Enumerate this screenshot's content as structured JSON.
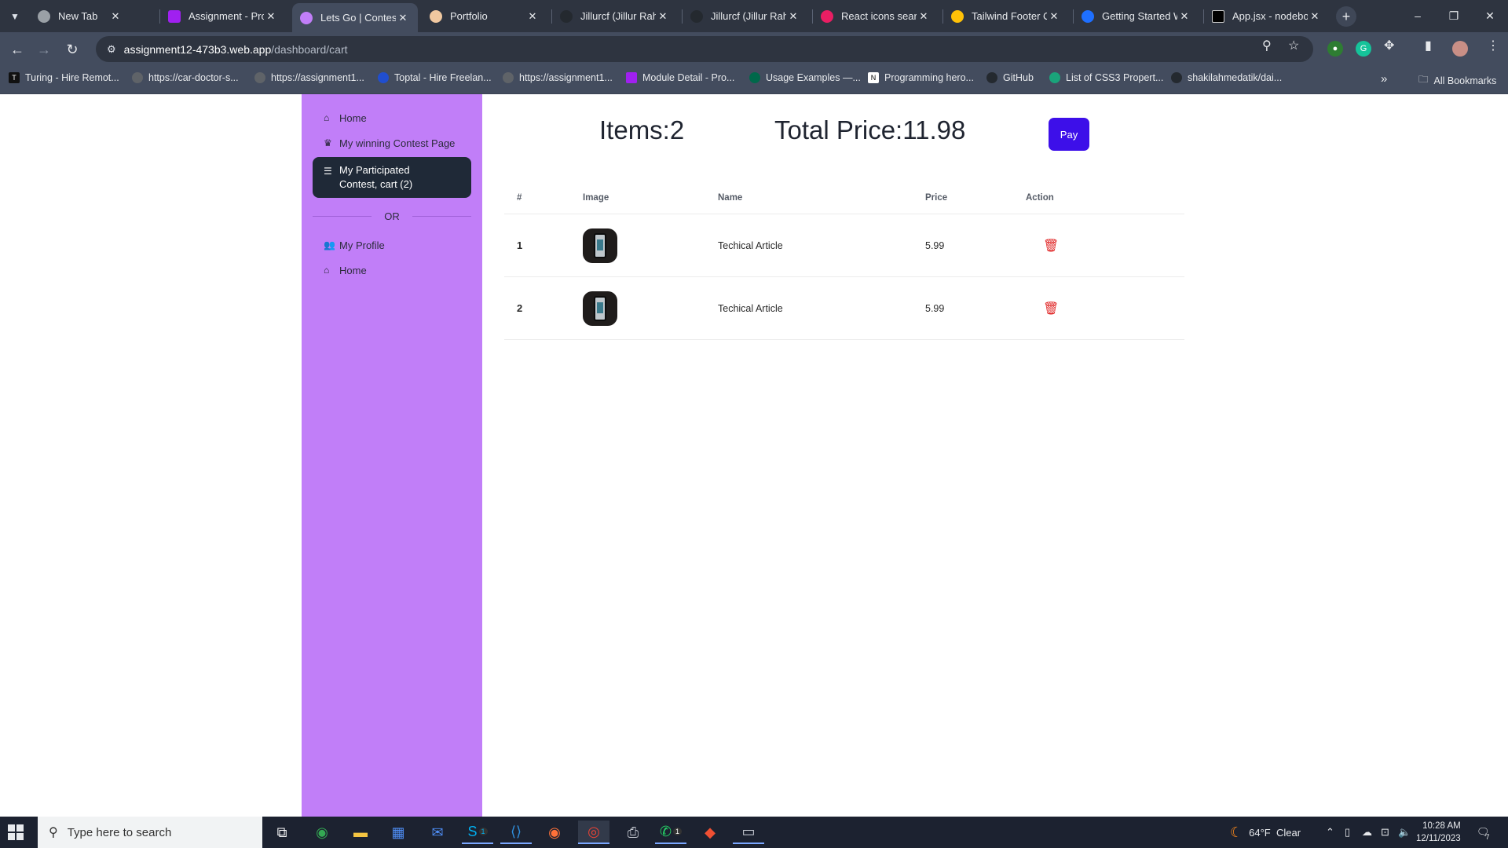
{
  "browser": {
    "tab_search_icon": "chevron-down-icon",
    "tabs": [
      {
        "title": "New Tab",
        "favicon_color": "#9aa0a6"
      },
      {
        "title": "Assignment - Pro",
        "favicon_color": "#a020f0"
      },
      {
        "title": "Lets Go | Contest",
        "favicon_color": "#c17ef8"
      },
      {
        "title": "Portfolio",
        "favicon_color": "#f0c8a0"
      },
      {
        "title": "Jillurcf (Jillur Rahm",
        "favicon_color": "#24292f"
      },
      {
        "title": "Jillurcf (Jillur Rahm",
        "favicon_color": "#24292f"
      },
      {
        "title": "React icons search",
        "favicon_color": "#e91e63"
      },
      {
        "title": "Tailwind Footer Co",
        "favicon_color": "#ffc107"
      },
      {
        "title": "Getting Started W",
        "favicon_color": "#1e6fff"
      },
      {
        "title": "App.jsx - nodebo",
        "favicon_color": "#000000"
      }
    ],
    "active_tab_index": 2,
    "new_tab_label": "+",
    "window_controls": {
      "minimize": "–",
      "restore": "❐",
      "close": "✕"
    },
    "address": {
      "host": "assignment12-473b3.web.app",
      "path": "/dashboard/cart"
    },
    "bookmarks": [
      {
        "label": "Turing - Hire Remot..."
      },
      {
        "label": "https://car-doctor-s..."
      },
      {
        "label": "https://assignment1..."
      },
      {
        "label": "Toptal - Hire Freelan..."
      },
      {
        "label": "https://assignment1..."
      },
      {
        "label": "Module Detail - Pro..."
      },
      {
        "label": "Usage Examples —..."
      },
      {
        "label": "Programming hero..."
      },
      {
        "label": "GitHub"
      },
      {
        "label": "List of CSS3 Propert..."
      },
      {
        "label": "shakilahmedatik/dai..."
      }
    ],
    "bookmarks_overflow": "»",
    "all_bookmarks": "All Bookmarks"
  },
  "sidebar": {
    "items_top": [
      {
        "label": "Home",
        "icon": "house-icon"
      },
      {
        "label": "My winning Contest Page",
        "icon": "trophy-icon"
      },
      {
        "label_line1": "My Participated",
        "label_line2": "Contest, cart (2)",
        "icon": "list-icon"
      }
    ],
    "divider_text": "OR",
    "items_bottom": [
      {
        "label": "My Profile",
        "icon": "users-icon"
      },
      {
        "label": "Home",
        "icon": "house-icon"
      }
    ]
  },
  "cart": {
    "items_text": "Items:2",
    "total_text": "Total Price:11.98",
    "pay_label": "Pay",
    "columns": [
      "#",
      "Image",
      "Name",
      "Price",
      "Action"
    ],
    "rows": [
      {
        "num": "1",
        "name": "Techical Article",
        "price": "5.99"
      },
      {
        "num": "2",
        "name": "Techical Article",
        "price": "5.99"
      }
    ]
  },
  "taskbar": {
    "search_placeholder": "Type here to search",
    "weather": "64°F  Clear",
    "time": "10:28 AM",
    "date": "12/11/2023",
    "notification_count": "7",
    "skype_badge": "1",
    "whatsapp_badge": "1"
  }
}
